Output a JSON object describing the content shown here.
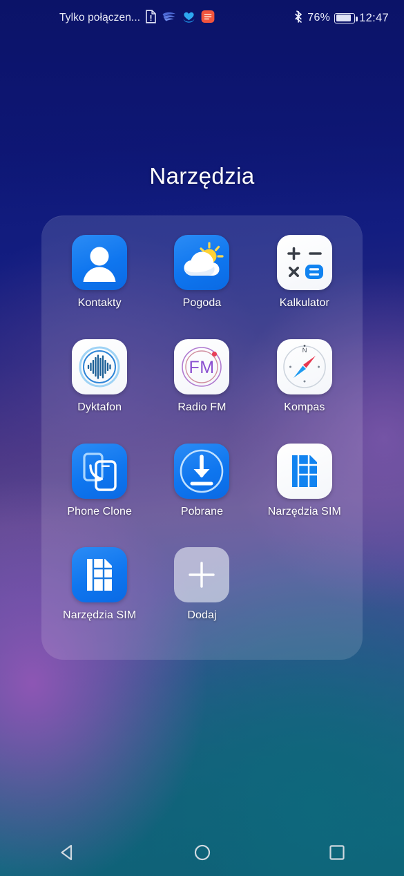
{
  "status_bar": {
    "carrier": "Tylko połączen...",
    "notification_icons": [
      {
        "name": "document-alert-icon"
      },
      {
        "name": "wave-swoosh-icon"
      },
      {
        "name": "heart-hands-icon"
      },
      {
        "name": "orange-app-icon"
      }
    ],
    "bluetooth_icon": "bluetooth-icon",
    "battery_percent": "76%",
    "battery_level": 76,
    "clock": "12:47"
  },
  "folder": {
    "title": "Narzędzia",
    "apps": [
      {
        "label": "Kontakty",
        "icon": "contacts-icon",
        "style": "bg-blue"
      },
      {
        "label": "Pogoda",
        "icon": "weather-icon",
        "style": "bg-blue"
      },
      {
        "label": "Kalkulator",
        "icon": "calculator-icon",
        "style": "bg-white"
      },
      {
        "label": "Dyktafon",
        "icon": "voice-recorder-icon",
        "style": "bg-white"
      },
      {
        "label": "Radio FM",
        "icon": "radio-fm-icon",
        "style": "bg-white"
      },
      {
        "label": "Kompas",
        "icon": "compass-icon",
        "style": "bg-white"
      },
      {
        "label": "Phone Clone",
        "icon": "phone-clone-icon",
        "style": "bg-blue"
      },
      {
        "label": "Pobrane",
        "icon": "downloads-icon",
        "style": "bg-blue"
      },
      {
        "label": "Narzędzia SIM",
        "icon": "sim-tools-icon",
        "style": "bg-white"
      },
      {
        "label": "Narzędzia SIM",
        "icon": "sim-tools-alt-icon",
        "style": "bg-blue"
      },
      {
        "label": "Dodaj",
        "icon": "add-plus-icon",
        "style": "bg-add"
      }
    ]
  },
  "nav_bar": {
    "back": "back-triangle-icon",
    "home": "home-circle-icon",
    "recents": "recents-square-icon"
  },
  "colors": {
    "accent_blue": "#0f76ef",
    "icon_white": "#ffffff",
    "compass_red": "#e8384f",
    "compass_blue": "#1f9bf0",
    "fm_purple": "#8a4fd0",
    "label_text": "#ffffff"
  }
}
